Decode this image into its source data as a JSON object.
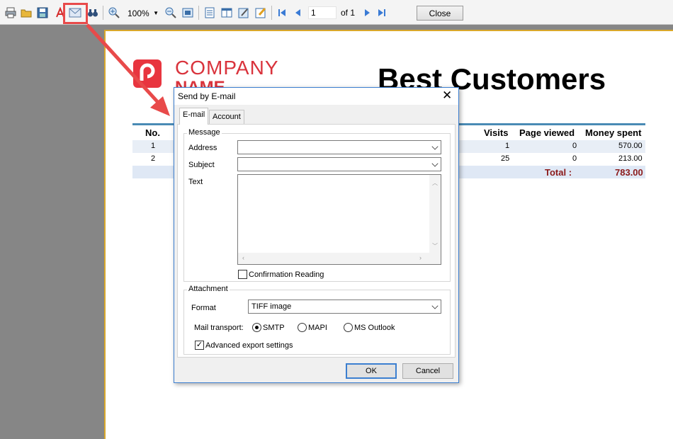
{
  "toolbar": {
    "zoom": "100%",
    "page_input": "1",
    "page_of": "of 1",
    "close_label": "Close",
    "icons": [
      "print-icon",
      "open-icon",
      "save-icon",
      "pdf-icon",
      "email-icon",
      "find-icon",
      "zoom-in-icon",
      "zoom-out-icon",
      "fit-page-icon",
      "single-page-icon",
      "two-pages-icon",
      "edit-icon",
      "settings-icon",
      "first-page-icon",
      "prev-page-icon",
      "next-page-icon",
      "last-page-icon"
    ]
  },
  "report": {
    "company_line1": "COMPANY",
    "company_line2": "NAME",
    "title": "Best Customers",
    "headers": {
      "no": "No.",
      "visits": "Visits",
      "page_viewed": "Page viewed",
      "money": "Money spent"
    },
    "rows": [
      {
        "no": "1",
        "visits": "1",
        "page_viewed": "0",
        "money": "570.00"
      },
      {
        "no": "2",
        "visits": "25",
        "page_viewed": "0",
        "money": "213.00"
      }
    ],
    "total_label": "Total :",
    "total_value": "783.00"
  },
  "dialog": {
    "title": "Send by E-mail",
    "tabs": [
      "E-mail",
      "Account"
    ],
    "message_group": "Message",
    "address_label": "Address",
    "address_value": "",
    "subject_label": "Subject",
    "subject_value": "",
    "text_label": "Text",
    "confirmation_label": "Confirmation Reading",
    "confirmation_checked": false,
    "attachment_group": "Attachment",
    "format_label": "Format",
    "format_value": "TIFF image",
    "transport_label": "Mail transport:",
    "transport_options": [
      "SMTP",
      "MAPI",
      "MS Outlook"
    ],
    "transport_selected": "SMTP",
    "advanced_label": "Advanced export settings",
    "advanced_checked": true,
    "ok_label": "OK",
    "cancel_label": "Cancel"
  },
  "colors": {
    "accent": "#e84a4a",
    "brand": "#d9333c",
    "dialog_border": "#3c7fd0",
    "rule": "#4a8bb5"
  }
}
